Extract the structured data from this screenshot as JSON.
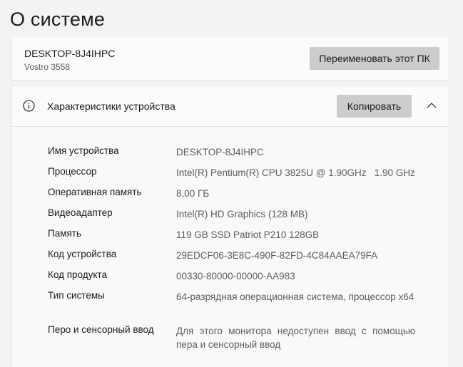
{
  "page": {
    "title": "О системе"
  },
  "device": {
    "name": "DESKTOP-8J4IHPC",
    "model": "Vostro 3558",
    "rename_label": "Переименовать этот ПК"
  },
  "specs": {
    "section_title": "Характеристики устройства",
    "copy_label": "Копировать",
    "icons": {
      "section": "info-icon",
      "collapse": "chevron-up-icon"
    },
    "rows": [
      {
        "label": "Имя устройства",
        "value": "DESKTOP-8J4IHPC"
      },
      {
        "label": "Процессор",
        "value": "Intel(R) Pentium(R) CPU 3825U @ 1.90GHz   1.90 GHz"
      },
      {
        "label": "Оперативная память",
        "value": "8,00 ГБ"
      },
      {
        "label": "Видеоадаптер",
        "value": "Intel(R) HD Graphics (128 MB)"
      },
      {
        "label": "Память",
        "value": "119 GB SSD Patriot P210 128GB"
      },
      {
        "label": "Код устройства",
        "value": "29EDCF06-3E8C-490F-82FD-4C84AAEA79FA"
      },
      {
        "label": "Код продукта",
        "value": "00330-80000-00000-AA983"
      },
      {
        "label": "Тип системы",
        "value": "64-разрядная операционная система, процессор x64"
      },
      {
        "label": "Перо и сенсорный ввод",
        "value": "Для этого монитора недоступен ввод с помощью пера и сенсорный ввод"
      }
    ]
  }
}
